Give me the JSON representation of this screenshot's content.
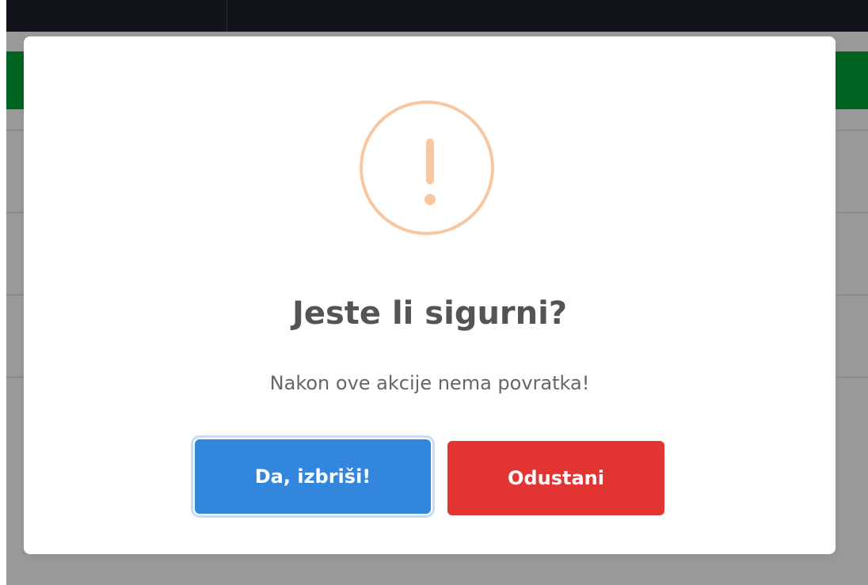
{
  "dialog": {
    "title": "Jeste li sigurni?",
    "message": "Nakon ove akcije nema povratka!",
    "icon": "warning-icon",
    "icon_color": "#f8c79f",
    "confirm_label": "Da, izbriši!",
    "cancel_label": "Odustani",
    "confirm_color": "#3286db",
    "cancel_color": "#e33434"
  },
  "background": {
    "top_bar_color": "#111418",
    "accent_color": "#00a63a",
    "overlay_color": "rgba(0, 0, 0, 0.4)"
  }
}
